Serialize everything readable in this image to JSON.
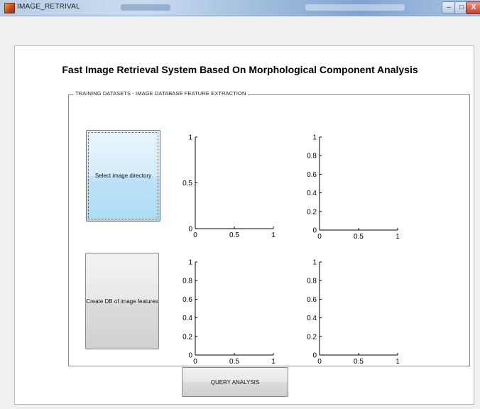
{
  "window": {
    "title": "IMAGE_RETRIVAL",
    "controls": {
      "minimize": "–",
      "maximize": "□",
      "close": "X"
    }
  },
  "heading": "Fast Image Retrieval System Based On Morphological Component Analysis",
  "panel": {
    "label": "TRAINING DATASETS - IMAGE DATABASE FEATURE EXTRACTION"
  },
  "buttons": {
    "select_dir": "Select image directory",
    "create_db": "Create DB of image features",
    "query": "QUERY ANALYSIS"
  },
  "chart_data": [
    {
      "type": "line",
      "series": [],
      "xlim": [
        0,
        1
      ],
      "ylim": [
        0,
        1
      ],
      "xticks": [
        "0",
        "0.5",
        "1"
      ],
      "yticks": [
        "0",
        "0.5",
        "1"
      ]
    },
    {
      "type": "line",
      "series": [],
      "xlim": [
        0,
        1
      ],
      "ylim": [
        0,
        1
      ],
      "xticks": [
        "0",
        "0.5",
        "1"
      ],
      "yticks": [
        "0",
        "0.2",
        "0.4",
        "0.6",
        "0.8",
        "1"
      ]
    },
    {
      "type": "line",
      "series": [],
      "xlim": [
        0,
        1
      ],
      "ylim": [
        0,
        1
      ],
      "xticks": [
        "0",
        "0.5",
        "1"
      ],
      "yticks": [
        "0",
        "0.2",
        "0.4",
        "0.6",
        "0.8",
        "1"
      ]
    },
    {
      "type": "line",
      "series": [],
      "xlim": [
        0,
        1
      ],
      "ylim": [
        0,
        1
      ],
      "xticks": [
        "0",
        "0.5",
        "1"
      ],
      "yticks": [
        "0",
        "0.2",
        "0.4",
        "0.6",
        "0.8",
        "1"
      ]
    }
  ]
}
